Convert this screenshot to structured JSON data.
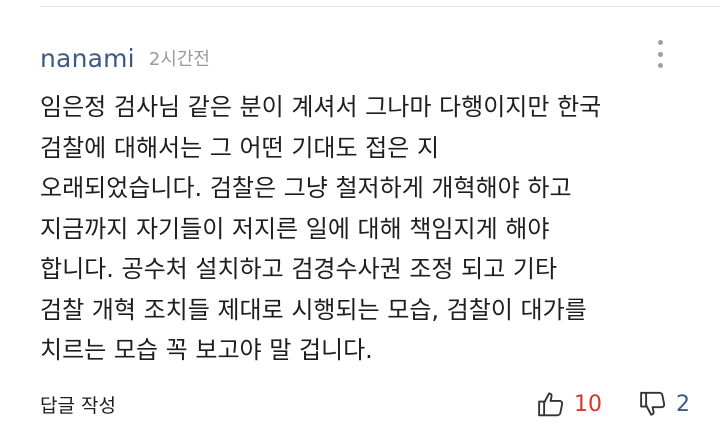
{
  "comment": {
    "author": "nanami",
    "time": "2시간전",
    "lines": [
      "임은정 검사님 같은 분이 계셔서 그나마 다행이지만 한국",
      "검찰에 대해서는 그 어떤 기대도 접은 지",
      "오래되었습니다. 검찰은 그냥 철저하게 개혁해야 하고",
      "지금까지 자기들이 저지른 일에 대해 책임지게 해야",
      "합니다. 공수처 설치하고 검경수사권 조정 되고 기타",
      "검찰 개혁 조치들 제대로 시행되는 모습, 검찰이 대가를",
      "치르는 모습 꼭 보고야 말 겁니다."
    ]
  },
  "footer": {
    "reply_label": "답글 작성",
    "like_count": "10",
    "dislike_count": "2"
  },
  "icons": {
    "more": "more-vertical-icon",
    "like": "thumbs-up-icon",
    "dislike": "thumbs-down-icon"
  },
  "colors": {
    "author": "#3b5a86",
    "like": "#d9362b",
    "dislike": "#3b5a86",
    "muted": "#9a9a9a"
  }
}
